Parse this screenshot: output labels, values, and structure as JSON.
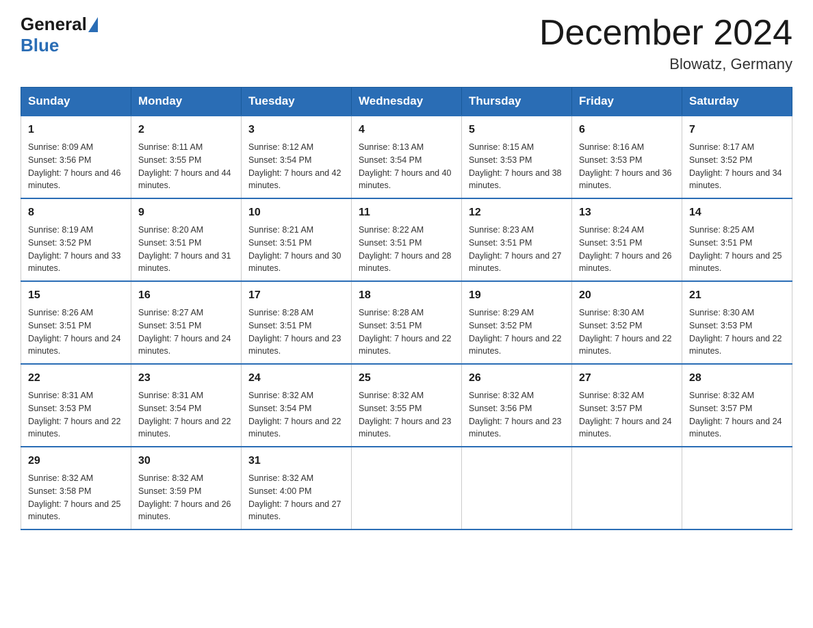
{
  "logo": {
    "general": "General",
    "blue": "Blue"
  },
  "title": "December 2024",
  "subtitle": "Blowatz, Germany",
  "days_of_week": [
    "Sunday",
    "Monday",
    "Tuesday",
    "Wednesday",
    "Thursday",
    "Friday",
    "Saturday"
  ],
  "weeks": [
    [
      {
        "day": 1,
        "sunrise": "8:09 AM",
        "sunset": "3:56 PM",
        "daylight": "7 hours and 46 minutes."
      },
      {
        "day": 2,
        "sunrise": "8:11 AM",
        "sunset": "3:55 PM",
        "daylight": "7 hours and 44 minutes."
      },
      {
        "day": 3,
        "sunrise": "8:12 AM",
        "sunset": "3:54 PM",
        "daylight": "7 hours and 42 minutes."
      },
      {
        "day": 4,
        "sunrise": "8:13 AM",
        "sunset": "3:54 PM",
        "daylight": "7 hours and 40 minutes."
      },
      {
        "day": 5,
        "sunrise": "8:15 AM",
        "sunset": "3:53 PM",
        "daylight": "7 hours and 38 minutes."
      },
      {
        "day": 6,
        "sunrise": "8:16 AM",
        "sunset": "3:53 PM",
        "daylight": "7 hours and 36 minutes."
      },
      {
        "day": 7,
        "sunrise": "8:17 AM",
        "sunset": "3:52 PM",
        "daylight": "7 hours and 34 minutes."
      }
    ],
    [
      {
        "day": 8,
        "sunrise": "8:19 AM",
        "sunset": "3:52 PM",
        "daylight": "7 hours and 33 minutes."
      },
      {
        "day": 9,
        "sunrise": "8:20 AM",
        "sunset": "3:51 PM",
        "daylight": "7 hours and 31 minutes."
      },
      {
        "day": 10,
        "sunrise": "8:21 AM",
        "sunset": "3:51 PM",
        "daylight": "7 hours and 30 minutes."
      },
      {
        "day": 11,
        "sunrise": "8:22 AM",
        "sunset": "3:51 PM",
        "daylight": "7 hours and 28 minutes."
      },
      {
        "day": 12,
        "sunrise": "8:23 AM",
        "sunset": "3:51 PM",
        "daylight": "7 hours and 27 minutes."
      },
      {
        "day": 13,
        "sunrise": "8:24 AM",
        "sunset": "3:51 PM",
        "daylight": "7 hours and 26 minutes."
      },
      {
        "day": 14,
        "sunrise": "8:25 AM",
        "sunset": "3:51 PM",
        "daylight": "7 hours and 25 minutes."
      }
    ],
    [
      {
        "day": 15,
        "sunrise": "8:26 AM",
        "sunset": "3:51 PM",
        "daylight": "7 hours and 24 minutes."
      },
      {
        "day": 16,
        "sunrise": "8:27 AM",
        "sunset": "3:51 PM",
        "daylight": "7 hours and 24 minutes."
      },
      {
        "day": 17,
        "sunrise": "8:28 AM",
        "sunset": "3:51 PM",
        "daylight": "7 hours and 23 minutes."
      },
      {
        "day": 18,
        "sunrise": "8:28 AM",
        "sunset": "3:51 PM",
        "daylight": "7 hours and 22 minutes."
      },
      {
        "day": 19,
        "sunrise": "8:29 AM",
        "sunset": "3:52 PM",
        "daylight": "7 hours and 22 minutes."
      },
      {
        "day": 20,
        "sunrise": "8:30 AM",
        "sunset": "3:52 PM",
        "daylight": "7 hours and 22 minutes."
      },
      {
        "day": 21,
        "sunrise": "8:30 AM",
        "sunset": "3:53 PM",
        "daylight": "7 hours and 22 minutes."
      }
    ],
    [
      {
        "day": 22,
        "sunrise": "8:31 AM",
        "sunset": "3:53 PM",
        "daylight": "7 hours and 22 minutes."
      },
      {
        "day": 23,
        "sunrise": "8:31 AM",
        "sunset": "3:54 PM",
        "daylight": "7 hours and 22 minutes."
      },
      {
        "day": 24,
        "sunrise": "8:32 AM",
        "sunset": "3:54 PM",
        "daylight": "7 hours and 22 minutes."
      },
      {
        "day": 25,
        "sunrise": "8:32 AM",
        "sunset": "3:55 PM",
        "daylight": "7 hours and 23 minutes."
      },
      {
        "day": 26,
        "sunrise": "8:32 AM",
        "sunset": "3:56 PM",
        "daylight": "7 hours and 23 minutes."
      },
      {
        "day": 27,
        "sunrise": "8:32 AM",
        "sunset": "3:57 PM",
        "daylight": "7 hours and 24 minutes."
      },
      {
        "day": 28,
        "sunrise": "8:32 AM",
        "sunset": "3:57 PM",
        "daylight": "7 hours and 24 minutes."
      }
    ],
    [
      {
        "day": 29,
        "sunrise": "8:32 AM",
        "sunset": "3:58 PM",
        "daylight": "7 hours and 25 minutes."
      },
      {
        "day": 30,
        "sunrise": "8:32 AM",
        "sunset": "3:59 PM",
        "daylight": "7 hours and 26 minutes."
      },
      {
        "day": 31,
        "sunrise": "8:32 AM",
        "sunset": "4:00 PM",
        "daylight": "7 hours and 27 minutes."
      },
      null,
      null,
      null,
      null
    ]
  ]
}
